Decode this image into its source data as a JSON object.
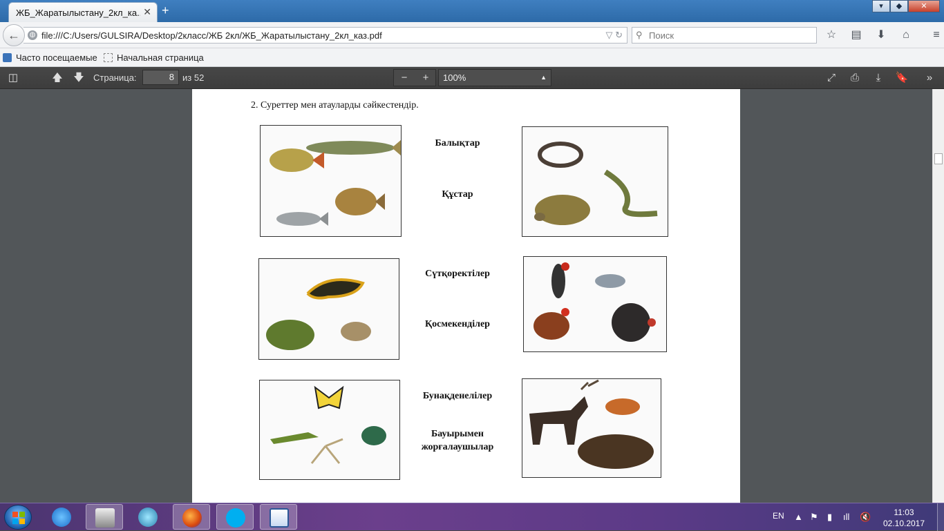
{
  "browser": {
    "tab_title": "ЖБ_Жаратылыстану_2кл_ка...",
    "tab_close": "✕",
    "new_tab": "+",
    "url": "file:///C:/Users/GULSIRA/Desktop/2класс/ЖБ 2кл/ЖБ_Жаратылыстану_2кл_каз.pdf",
    "search_placeholder": "Поиск",
    "bookmarks": [
      "Часто посещаемые",
      "Начальная страница"
    ]
  },
  "pdf_toolbar": {
    "page_label": "Страница:",
    "page_number": "8",
    "page_total": "из 52",
    "zoom": "100%"
  },
  "document": {
    "task": "2. Суреттер мен  атауларды  сәйкестендір.",
    "labels": {
      "fish": "Балықтар",
      "birds": "Құстар",
      "mammals": "Сүтқоректілер",
      "amphibians": "Қосмекенділер",
      "insects": "Бунақденелілер",
      "reptiles_1": "Бауырымен",
      "reptiles_2": "жорғалаушылар"
    },
    "images": [
      {
        "subject": "fish: pike, perch, bream, roach"
      },
      {
        "subject": "reptiles: snake, tortoise, lizard"
      },
      {
        "subject": "amphibians: salamander, frogs"
      },
      {
        "subject": "birds: woodpecker, pigeon, rooster, turkey"
      },
      {
        "subject": "insects: butterfly, grasshopper, dragonfly, beetle"
      },
      {
        "subject": "mammals: moose, fox, bear"
      }
    ]
  },
  "taskbar": {
    "language": "EN",
    "time": "11:03",
    "date": "02.10.2017"
  },
  "colors": {
    "titlebar": "#2d6aa8",
    "pdf_toolbar": "#424242",
    "viewer_bg": "#525659",
    "taskbar": "#5b3a87"
  }
}
